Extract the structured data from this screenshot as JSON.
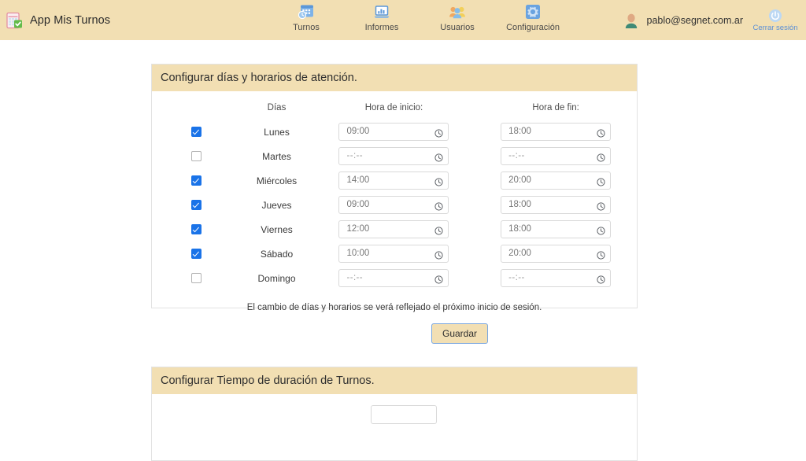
{
  "app": {
    "brand_title": "App Mis Turnos",
    "logo_icon": "calendar-check-icon",
    "accent_bar_color": "#f2dfb3",
    "checkbox_color": "#1a73e8",
    "link_color": "#5b8fd6"
  },
  "nav": {
    "items": [
      {
        "label": "Turnos",
        "icon": "calendar-clock-icon"
      },
      {
        "label": "Informes",
        "icon": "laptop-chart-icon"
      },
      {
        "label": "Usuarios",
        "icon": "users-group-icon"
      },
      {
        "label": "Configuración",
        "icon": "gear-icon"
      }
    ]
  },
  "user": {
    "avatar_icon": "user-avatar-icon",
    "email": "pablo@segnet.com.ar",
    "logout_label": "Cerrar sesión",
    "logout_icon": "power-icon"
  },
  "schedule_panel": {
    "title": "Configurar días y horarios de atención.",
    "headers": {
      "days": "Días",
      "start": "Hora de inicio:",
      "end": "Hora de fin:"
    },
    "empty_time": "--:--",
    "clock_icon": "clock-icon",
    "rows": [
      {
        "day": "Lunes",
        "checked": true,
        "start": "09:00",
        "end": "18:00"
      },
      {
        "day": "Martes",
        "checked": false,
        "start": "--:--",
        "end": "--:--"
      },
      {
        "day": "Miércoles",
        "checked": true,
        "start": "14:00",
        "end": "20:00"
      },
      {
        "day": "Jueves",
        "checked": true,
        "start": "09:00",
        "end": "18:00"
      },
      {
        "day": "Viernes",
        "checked": true,
        "start": "12:00",
        "end": "18:00"
      },
      {
        "day": "Sábado",
        "checked": true,
        "start": "10:00",
        "end": "20:00"
      },
      {
        "day": "Domingo",
        "checked": false,
        "start": "--:--",
        "end": "--:--"
      }
    ],
    "note": "El cambio de días y horarios se verá reflejado el próximo inicio de sesión.",
    "save_label": "Guardar"
  },
  "duration_panel": {
    "title": "Configurar Tiempo de duración de Turnos."
  }
}
